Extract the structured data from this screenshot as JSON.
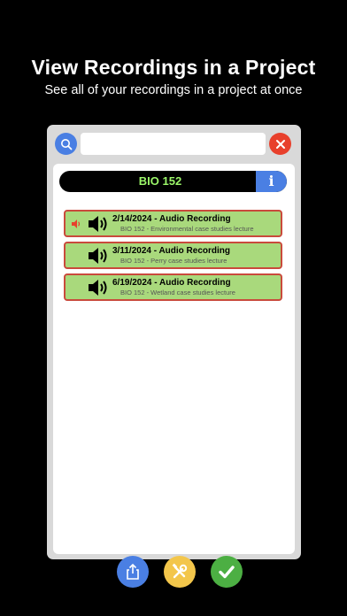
{
  "promo": {
    "headline": "View Recordings in a Project",
    "subline": "See all of your recordings in a project at once"
  },
  "search": {
    "placeholder": "",
    "value": ""
  },
  "project": {
    "name": "BIO 152",
    "info_label": "i"
  },
  "recordings": [
    {
      "title": "2/14/2024 - Audio Recording",
      "subtitle": "BIO 152 - Environmental case studies lecture",
      "playing": true
    },
    {
      "title": "3/11/2024 - Audio Recording",
      "subtitle": "BIO 152 - Perry case studies lecture",
      "playing": false
    },
    {
      "title": "6/19/2024 - Audio Recording",
      "subtitle": "BIO 152 - Wetland case studies lecture",
      "playing": false
    }
  ],
  "icons": {
    "search": "search-icon",
    "close": "close-icon",
    "speaker": "speaker-icon",
    "share": "share-icon",
    "tools": "tools-icon",
    "done": "checkmark-icon"
  },
  "colors": {
    "accent_blue": "#4a7fe3",
    "close_red": "#e8402c",
    "record_bg": "#a9d97c",
    "record_border": "#c94a3c",
    "project_title": "#9cf76a",
    "tools_yellow": "#f3c64b",
    "done_green": "#4caf43"
  }
}
